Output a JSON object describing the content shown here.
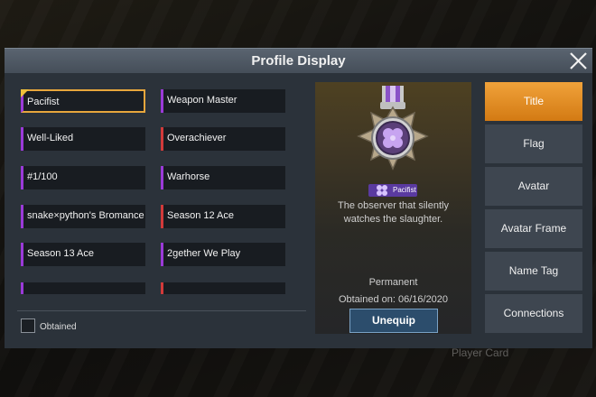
{
  "background": {
    "footer_text": "Player Card"
  },
  "dialog": {
    "title": "Profile Display",
    "close_icon": "close-x"
  },
  "titles_list": {
    "items": [
      {
        "label": "Pacifist",
        "color": "purple",
        "selected": true
      },
      {
        "label": "Weapon Master",
        "color": "purple"
      },
      {
        "label": "Well-Liked",
        "color": "purple"
      },
      {
        "label": "Overachiever",
        "color": "red"
      },
      {
        "label": "#1/100",
        "color": "purple"
      },
      {
        "label": "Warhorse",
        "color": "purple"
      },
      {
        "label": "snake×python's Bromance",
        "color": "purple"
      },
      {
        "label": "Season 12 Ace",
        "color": "red"
      },
      {
        "label": "Season 13 Ace",
        "color": "purple"
      },
      {
        "label": "2gether We Play",
        "color": "purple"
      }
    ],
    "filter_label": "Obtained",
    "filter_checked": false
  },
  "detail": {
    "badge_label": "Pacifist",
    "description": "The observer that silently watches the slaughter.",
    "duration": "Permanent",
    "obtained_on": "Obtained on: 06/16/2020",
    "action_label": "Unequip"
  },
  "tabs": [
    {
      "label": "Title",
      "active": true
    },
    {
      "label": "Flag"
    },
    {
      "label": "Avatar"
    },
    {
      "label": "Avatar Frame"
    },
    {
      "label": "Name Tag"
    },
    {
      "label": "Connections"
    }
  ],
  "colors": {
    "accent_orange": "#e7a63c",
    "title_purple": "#9b3ad8",
    "title_red": "#d23a3a",
    "button_blue": "#2c4d6c"
  }
}
